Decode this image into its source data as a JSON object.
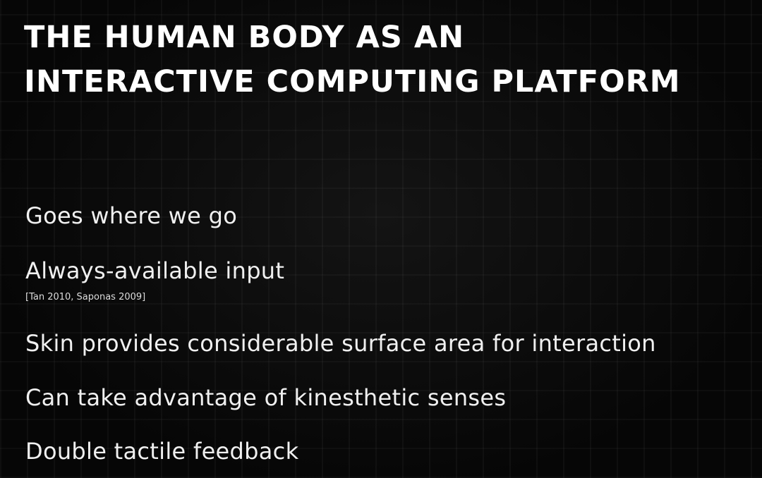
{
  "slide": {
    "title_line1": "THE HUMAN BODY AS AN",
    "title_line2": "INTERACTIVE COMPUTING PLATFORM",
    "bullets": [
      "Goes where we go",
      "Always-available input",
      "Skin provides considerable surface area for interaction",
      "Can take advantage of kinesthetic senses",
      "Double tactile feedback"
    ],
    "citation": "[Tan 2010, Saponas 2009]"
  }
}
